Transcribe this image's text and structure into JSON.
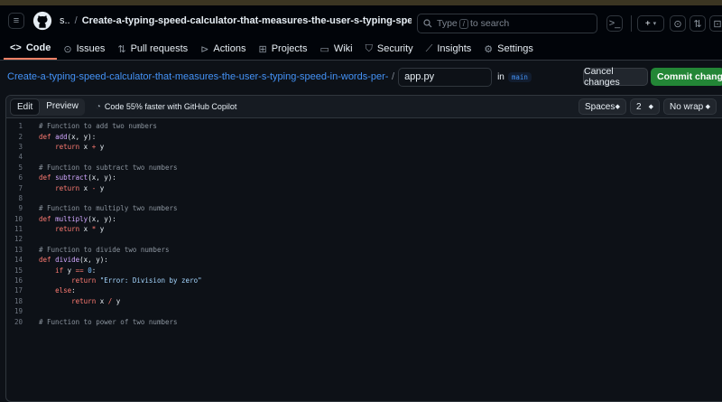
{
  "header": {
    "owner": "s..",
    "separator": "/",
    "repo": "Create-a-typing-speed-calculator-that-measures-the-user-s-typing-speed-in-words-per-minute-WP...",
    "search_prefix": "Type",
    "search_key": "/",
    "search_suffix": "to search",
    "plus_label": "+",
    "plus_caret": "▾"
  },
  "tabs": [
    {
      "label": "Code",
      "icon": "code-icon"
    },
    {
      "label": "Issues",
      "icon": "issue-icon"
    },
    {
      "label": "Pull requests",
      "icon": "pull-request-icon"
    },
    {
      "label": "Actions",
      "icon": "play-icon"
    },
    {
      "label": "Projects",
      "icon": "table-icon"
    },
    {
      "label": "Wiki",
      "icon": "book-icon"
    },
    {
      "label": "Security",
      "icon": "shield-icon"
    },
    {
      "label": "Insights",
      "icon": "graph-icon"
    },
    {
      "label": "Settings",
      "icon": "gear-icon"
    }
  ],
  "filebar": {
    "path": "Create-a-typing-speed-calculator-that-measures-the-user-s-typing-speed-in-words-per-minute-WPM-.",
    "path_sep": "/",
    "filename": "app.py",
    "in_label": "in",
    "branch": "main",
    "cancel_label": "Cancel changes",
    "commit_label": "Commit changes..."
  },
  "editor": {
    "edit_tab": "Edit",
    "preview_tab": "Preview",
    "copilot_text": "Code 55% faster with GitHub Copilot",
    "indent_mode": "Spaces",
    "indent_size": "2",
    "wrap_mode": "No wrap"
  },
  "code_lines": [
    "# Function to add two numbers",
    "def add(x, y):",
    "    return x + y",
    "",
    "# Function to subtract two numbers",
    "def subtract(x, y):",
    "    return x - y",
    "",
    "# Function to multiply two numbers",
    "def multiply(x, y):",
    "    return x * y",
    "",
    "# Function to divide two numbers",
    "def divide(x, y):",
    "    if y == 0:",
    "        return \"Error: Division by zero\"",
    "    else:",
    "        return x / y",
    "",
    "# Function to power of two numbers"
  ],
  "colors": {
    "accent_tab": "#f78166",
    "link": "#4493f8",
    "commit_button": "#238636",
    "background": "#0d1117"
  }
}
